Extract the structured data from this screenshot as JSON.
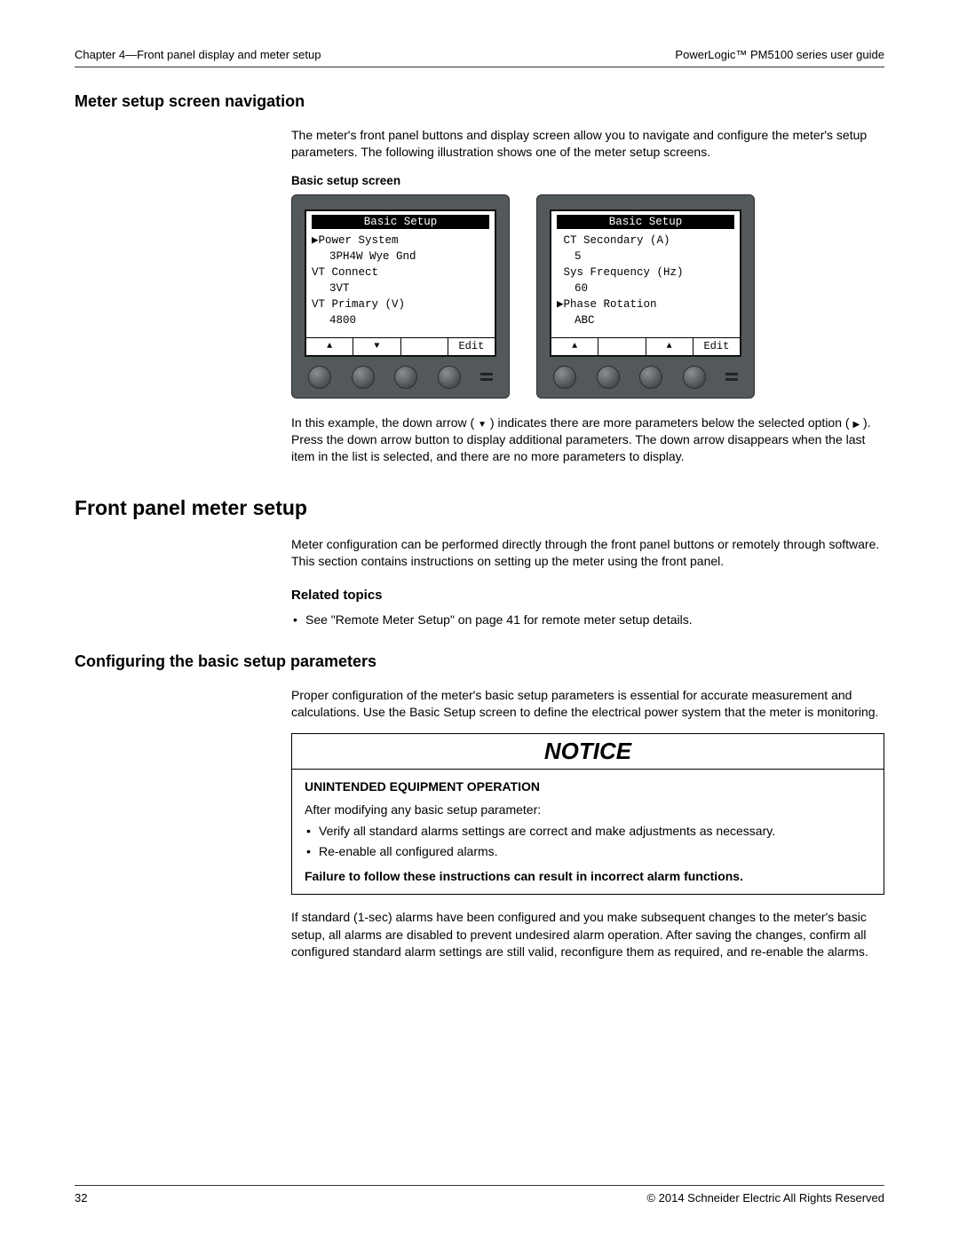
{
  "header": {
    "left": "Chapter 4—Front panel display and meter setup",
    "right": "PowerLogic™  PM5100 series user guide"
  },
  "sec1": {
    "h2": "Meter setup screen navigation",
    "p1": "The meter's front panel buttons and display screen allow you to navigate and configure the meter's setup parameters. The following illustration shows one of the meter setup screens.",
    "caption": "Basic setup screen",
    "p2a": "In this example, the down arrow (",
    "p2b": ") indicates there are more parameters below the selected option (",
    "p2c": "). Press the down arrow button to display additional parameters. The down arrow disappears when the last item in the list is selected, and there are no more parameters to display."
  },
  "screen_left": {
    "title": "Basic Setup",
    "r1": "▶Power System",
    "v1": "3PH4W Wye Gnd",
    "r2": "VT Connect",
    "v2": "3VT",
    "r3": "VT Primary (V)",
    "v3": "4800",
    "foot1": "▲",
    "foot2": "▼",
    "foot3": "",
    "foot4": "Edit"
  },
  "screen_right": {
    "title": "Basic Setup",
    "r1": " CT Secondary (A)",
    "v1": "5",
    "r2": " Sys Frequency (Hz)",
    "v2": "60",
    "r3": "▶Phase Rotation",
    "v3": "ABC",
    "foot1": "▲",
    "foot2": "",
    "foot3": "▲",
    "foot4": "Edit"
  },
  "sec2": {
    "h1": "Front panel meter setup",
    "p1": "Meter configuration can be performed directly through the front panel buttons or remotely through software. This section contains instructions on setting up the meter using the front panel.",
    "h3": "Related topics",
    "b1": "See \"Remote Meter Setup\" on page 41 for remote meter setup details."
  },
  "sec3": {
    "h2": "Configuring the basic setup parameters",
    "p1": "Proper configuration of the meter's basic setup parameters is essential for accurate measurement and calculations. Use the Basic Setup screen to define the electrical power system that the meter is monitoring."
  },
  "notice": {
    "title": "NOTICE",
    "sub": "UNINTENDED EQUIPMENT OPERATION",
    "p1": "After modifying any basic setup parameter:",
    "b1": "Verify all standard alarms settings are correct and make adjustments as necessary.",
    "b2": "Re-enable all configured alarms.",
    "warn": "Failure to follow these instructions can result in incorrect alarm functions."
  },
  "after": {
    "p1": "If standard (1-sec) alarms have been configured and you make subsequent changes to the meter's basic setup, all alarms are disabled to prevent undesired alarm operation. After saving the changes, confirm all configured standard alarm settings are still valid, reconfigure them as required, and re-enable the alarms."
  },
  "footer": {
    "left": "32",
    "right": "© 2014 Schneider Electric All Rights Reserved"
  }
}
